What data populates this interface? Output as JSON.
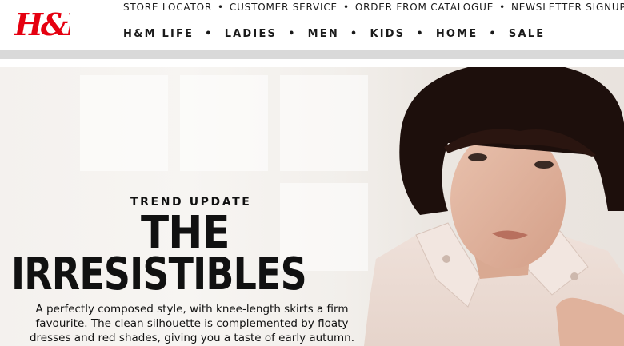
{
  "brand": {
    "logo_text": "H&M"
  },
  "utility_nav": [
    {
      "label": "STORE LOCATOR"
    },
    {
      "label": "CUSTOMER SERVICE"
    },
    {
      "label": "ORDER FROM CATALOGUE"
    },
    {
      "label": "NEWSLETTER SIGNUP"
    }
  ],
  "nav_separator": "•",
  "main_nav": [
    {
      "label": "H&M LIFE"
    },
    {
      "label": "LADIES"
    },
    {
      "label": "MEN"
    },
    {
      "label": "KIDS"
    },
    {
      "label": "HOME"
    },
    {
      "label": "SALE"
    }
  ],
  "hero": {
    "kicker": "TREND UPDATE",
    "title_line1": "THE",
    "title_line2": "IRRESISTIBLES",
    "description_lines": [
      "A perfectly composed style, with knee-length skirts a firm",
      "favourite. The clean silhouette is complemented by floaty",
      "dresses and red shades, giving you a taste of early autumn."
    ]
  },
  "colors": {
    "brand_red": "#e50010",
    "nav_text": "#1a1a1a",
    "divider_grey": "#d9d9d9"
  }
}
